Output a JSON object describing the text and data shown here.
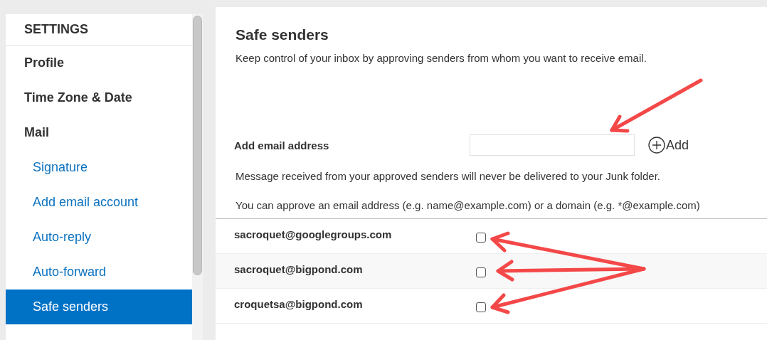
{
  "sidebar": {
    "title": "SETTINGS",
    "items": [
      {
        "label": "Profile",
        "kind": "section",
        "selected": false
      },
      {
        "label": "Time Zone & Date",
        "kind": "section",
        "selected": false
      },
      {
        "label": "Mail",
        "kind": "section",
        "selected": false
      },
      {
        "label": "Signature",
        "kind": "link",
        "selected": false
      },
      {
        "label": "Add email account",
        "kind": "link",
        "selected": false
      },
      {
        "label": "Auto-reply",
        "kind": "link",
        "selected": false
      },
      {
        "label": "Auto-forward",
        "kind": "link",
        "selected": false
      },
      {
        "label": "Safe senders",
        "kind": "link",
        "selected": true
      }
    ]
  },
  "main": {
    "title": "Safe senders",
    "description": "Keep control of your inbox by approving senders from whom you want to receive email.",
    "add_label": "Add email address",
    "add_button": "Add",
    "notes": [
      "Message received from your approved senders will never be delivered to your Junk folder.",
      "You can approve an email address (e.g. name@example.com) or a domain (e.g. *@example.com)"
    ],
    "senders": [
      {
        "email": "sacroquet@googlegroups.com",
        "checked": false
      },
      {
        "email": "sacroquet@bigpond.com",
        "checked": false
      },
      {
        "email": "croquetsa@bigpond.com",
        "checked": false
      }
    ]
  }
}
